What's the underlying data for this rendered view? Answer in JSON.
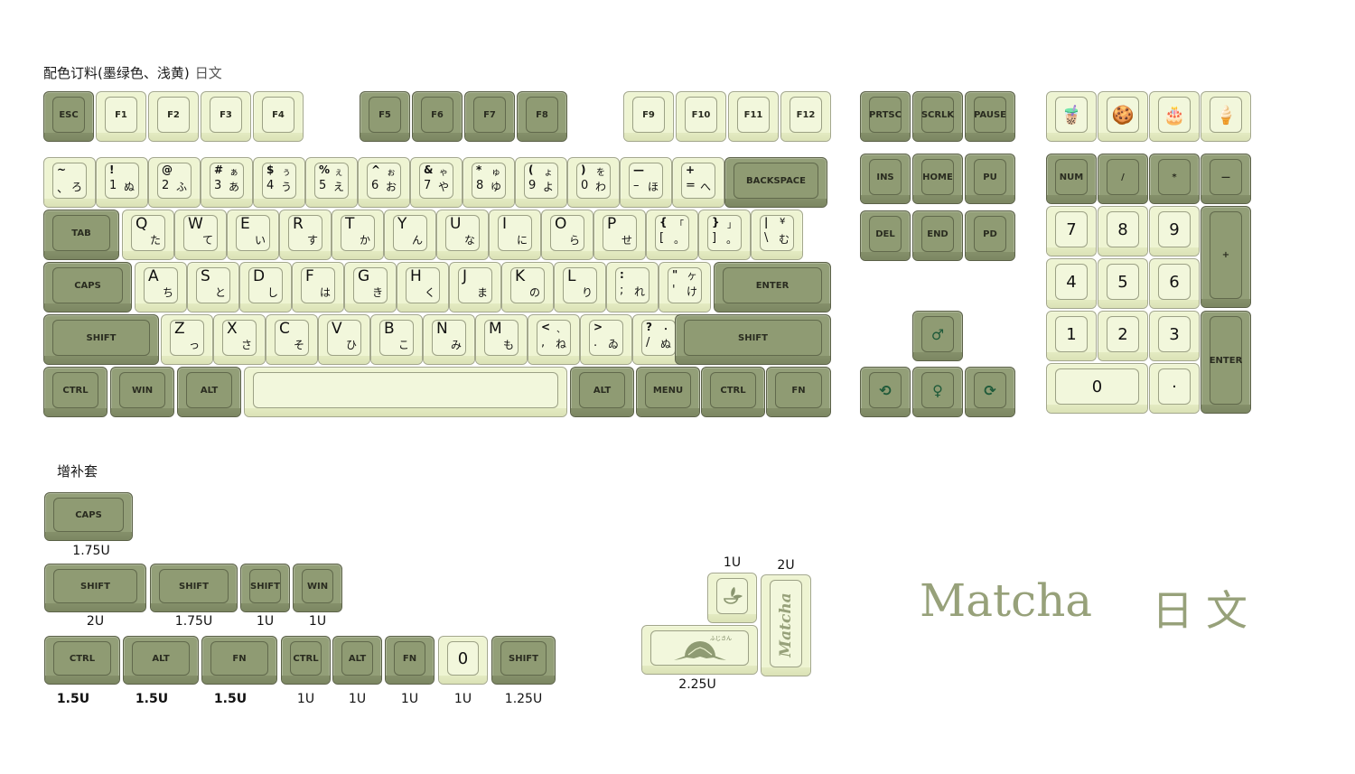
{
  "header": {
    "title": "配色订料(墨绿色、浅黄)",
    "title_sub": "日文"
  },
  "extras_title": "增补套",
  "colors": {
    "dark_green": "#939f78",
    "cream": "#eef4d2",
    "brand_text": "#97a17a"
  },
  "fn_row": [
    {
      "label": "ESC",
      "color": "g"
    },
    {
      "label": "F1",
      "color": "y"
    },
    {
      "label": "F2",
      "color": "y"
    },
    {
      "label": "F3",
      "color": "y"
    },
    {
      "label": "F4",
      "color": "y"
    },
    {
      "label": "F5",
      "color": "g"
    },
    {
      "label": "F6",
      "color": "g"
    },
    {
      "label": "F7",
      "color": "g"
    },
    {
      "label": "F8",
      "color": "g"
    },
    {
      "label": "F9",
      "color": "y"
    },
    {
      "label": "F10",
      "color": "y"
    },
    {
      "label": "F11",
      "color": "y"
    },
    {
      "label": "F12",
      "color": "y"
    }
  ],
  "number_row": [
    {
      "tl": "~",
      "bl": "、",
      "tr": "",
      "br": "ろ"
    },
    {
      "tl": "!",
      "bl": "1",
      "tr": "",
      "br": "ぬ"
    },
    {
      "tl": "@",
      "bl": "2",
      "tr": "",
      "br": "ふ"
    },
    {
      "tl": "#",
      "bl": "3",
      "tr": "ぁ",
      "br": "あ"
    },
    {
      "tl": "$",
      "bl": "4",
      "tr": "ぅ",
      "br": "う"
    },
    {
      "tl": "%",
      "bl": "5",
      "tr": "ぇ",
      "br": "え"
    },
    {
      "tl": "^",
      "bl": "6",
      "tr": "ぉ",
      "br": "お"
    },
    {
      "tl": "&",
      "bl": "7",
      "tr": "ゃ",
      "br": "や"
    },
    {
      "tl": "*",
      "bl": "8",
      "tr": "ゅ",
      "br": "ゆ"
    },
    {
      "tl": "(",
      "bl": "9",
      "tr": "ょ",
      "br": "よ"
    },
    {
      "tl": ")",
      "bl": "0",
      "tr": "を",
      "br": "わ"
    },
    {
      "tl": "—",
      "bl": "–",
      "tr": "",
      "br": "ほ"
    },
    {
      "tl": "+",
      "bl": "=",
      "tr": "",
      "br": "へ"
    }
  ],
  "backspace": "BACKSPACE",
  "tab": "TAB",
  "q_row": [
    {
      "main": "Q",
      "kana": "た"
    },
    {
      "main": "W",
      "kana": "て"
    },
    {
      "main": "E",
      "kana": "い"
    },
    {
      "main": "R",
      "kana": "す"
    },
    {
      "main": "T",
      "kana": "か"
    },
    {
      "main": "Y",
      "kana": "ん"
    },
    {
      "main": "U",
      "kana": "な"
    },
    {
      "main": "I",
      "kana": "に"
    },
    {
      "main": "O",
      "kana": "ら"
    },
    {
      "main": "P",
      "kana": "せ"
    }
  ],
  "q_row_sym": [
    {
      "tl": "{",
      "bl": "[",
      "tr": "「",
      "br": "。"
    },
    {
      "tl": "}",
      "bl": "]",
      "tr": "」",
      "br": "。"
    },
    {
      "tl": "|",
      "bl": "\\",
      "tr": "¥",
      "br": "む"
    }
  ],
  "caps": "CAPS",
  "a_row": [
    {
      "main": "A",
      "kana": "ち"
    },
    {
      "main": "S",
      "kana": "と"
    },
    {
      "main": "D",
      "kana": "し"
    },
    {
      "main": "F",
      "kana": "は"
    },
    {
      "main": "G",
      "kana": "き"
    },
    {
      "main": "H",
      "kana": "く"
    },
    {
      "main": "J",
      "kana": "ま"
    },
    {
      "main": "K",
      "kana": "の"
    },
    {
      "main": "L",
      "kana": "り"
    }
  ],
  "a_row_sym": [
    {
      "tl": ":",
      "bl": ";",
      "tr": "",
      "br": "れ"
    },
    {
      "tl": "\"",
      "bl": "'",
      "tr": "ケ",
      "br": "け"
    }
  ],
  "enter": "ENTER",
  "shift": "SHIFT",
  "z_row": [
    {
      "main": "Z",
      "kana": "っ"
    },
    {
      "main": "X",
      "kana": "さ"
    },
    {
      "main": "C",
      "kana": "そ"
    },
    {
      "main": "V",
      "kana": "ひ"
    },
    {
      "main": "B",
      "kana": "こ"
    },
    {
      "main": "N",
      "kana": "み"
    },
    {
      "main": "M",
      "kana": "も"
    }
  ],
  "z_row_sym": [
    {
      "tl": "<",
      "bl": ",",
      "tr": "、",
      "br": "ね"
    },
    {
      "tl": ">",
      "bl": ".",
      "tr": "",
      "br": "ゐ"
    },
    {
      "tl": "?",
      "bl": "/",
      "tr": "・",
      "br": "ぬ"
    }
  ],
  "bottom_row": {
    "ctrl": "CTRL",
    "win": "WIN",
    "alt": "ALT",
    "space": "",
    "alt_r": "ALT",
    "menu": "MENU",
    "ctrl_r": "CTRL",
    "fn": "FN"
  },
  "nav_top": [
    "PRTSC",
    "SCRLK",
    "PAUSE"
  ],
  "nav_mid": [
    "INS",
    "HOME",
    "PU"
  ],
  "nav_bot": [
    "DEL",
    "END",
    "PD"
  ],
  "arrows": {
    "up": "♂",
    "left": "⟲",
    "down": "♀",
    "right": "⟳"
  },
  "arrow_icons": {
    "up": "arrow-up-icon",
    "left": "arrow-left-icon",
    "down": "arrow-down-icon",
    "right": "arrow-right-icon"
  },
  "food_keys": [
    {
      "icon": "🧋",
      "name": "bubble-tea-icon"
    },
    {
      "icon": "🍪",
      "name": "cookie-icon"
    },
    {
      "icon": "🎂",
      "name": "cake-icon"
    },
    {
      "icon": "🍦",
      "name": "ice-cream-icon"
    }
  ],
  "numpad": {
    "num": "NUM",
    "div": "/",
    "mul": "*",
    "minus": "—",
    "n7": "7",
    "n8": "8",
    "n9": "9",
    "plus": "+",
    "n4": "4",
    "n5": "5",
    "n6": "6",
    "n1": "1",
    "n2": "2",
    "n3": "3",
    "enter": "ENTER",
    "n0": "0",
    "dot": "·"
  },
  "extras": {
    "caps": {
      "label": "CAPS",
      "size": "1.75U"
    },
    "row2": [
      {
        "label": "SHIFT",
        "size": "2U"
      },
      {
        "label": "SHIFT",
        "size": "1.75U"
      },
      {
        "label": "SHIFT",
        "size": "1U"
      },
      {
        "label": "WIN",
        "size": "1U"
      }
    ],
    "row3": [
      {
        "label": "CTRL",
        "size": "1.5U"
      },
      {
        "label": "ALT",
        "size": "1.5U"
      },
      {
        "label": "FN",
        "size": "1.5U"
      },
      {
        "label": "CTRL",
        "size": "1U"
      },
      {
        "label": "ALT",
        "size": "1U"
      },
      {
        "label": "FN",
        "size": "1U"
      },
      {
        "label": "0",
        "size": "1U"
      },
      {
        "label": "SHIFT",
        "size": "1.25U"
      }
    ],
    "novelty": {
      "tea_size": "1U",
      "matcha_size": "2U",
      "fuji_size": "2.25U",
      "fuji_text": "ふじさん",
      "matcha_text": "Matcha"
    }
  },
  "brand": {
    "name": "Matcha",
    "lang": "日文"
  }
}
